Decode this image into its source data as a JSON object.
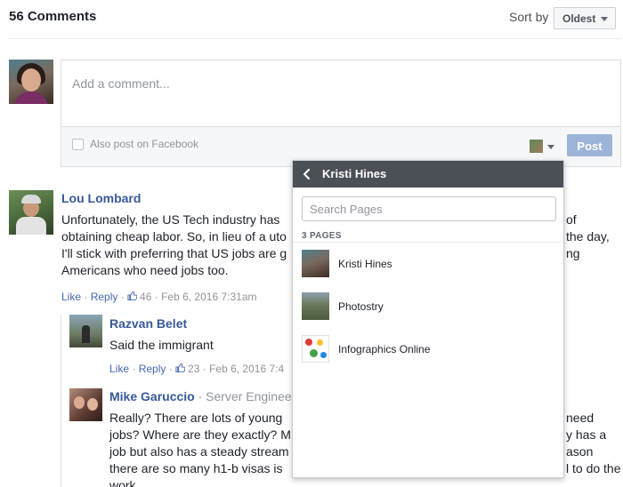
{
  "header": {
    "comment_count": "56 Comments",
    "sort_label": "Sort by",
    "sort_value": "Oldest"
  },
  "composer": {
    "placeholder": "Add a comment...",
    "also_post_label": "Also post on Facebook",
    "post_label": "Post"
  },
  "comments": [
    {
      "author": "Lou Lombard",
      "text_lines": [
        "Unfortunately, the US Tech industry has",
        "obtaining cheap labor. So, in lieu of a uto",
        "I'll stick with preferring that US jobs are g",
        "Americans who need jobs too."
      ],
      "text_right_lines": [
        "of",
        "the day,",
        "ng"
      ],
      "like": "Like",
      "reply": "Reply",
      "likes": "46",
      "timestamp": "Feb 6, 2016 7:31am"
    },
    {
      "author": "Razvan Belet",
      "text": "Said the immigrant",
      "like": "Like",
      "reply": "Reply",
      "likes": "23",
      "timestamp": "Feb 6, 2016 7:4"
    },
    {
      "author": "Mike Garuccio",
      "title": "· Server Enginee",
      "text_lines": [
        "Really? There are lots of young",
        "jobs? Where are they exactly? M",
        "job but also has a steady stream",
        "there are so many h1-b visas is",
        "work"
      ],
      "text_right_lines": [
        "need",
        "y has a",
        "ason",
        "l to do the"
      ]
    }
  ],
  "popup": {
    "title": "Kristi Hines",
    "search_placeholder": "Search Pages",
    "section_label": "3 PAGES",
    "pages": [
      {
        "name": "Kristi Hines"
      },
      {
        "name": "Photostry"
      },
      {
        "name": "Infographics Online"
      }
    ]
  },
  "colors": {
    "link": "#365899",
    "post_button": "#9cb4d8",
    "popup_bar": "#4b4f56"
  }
}
